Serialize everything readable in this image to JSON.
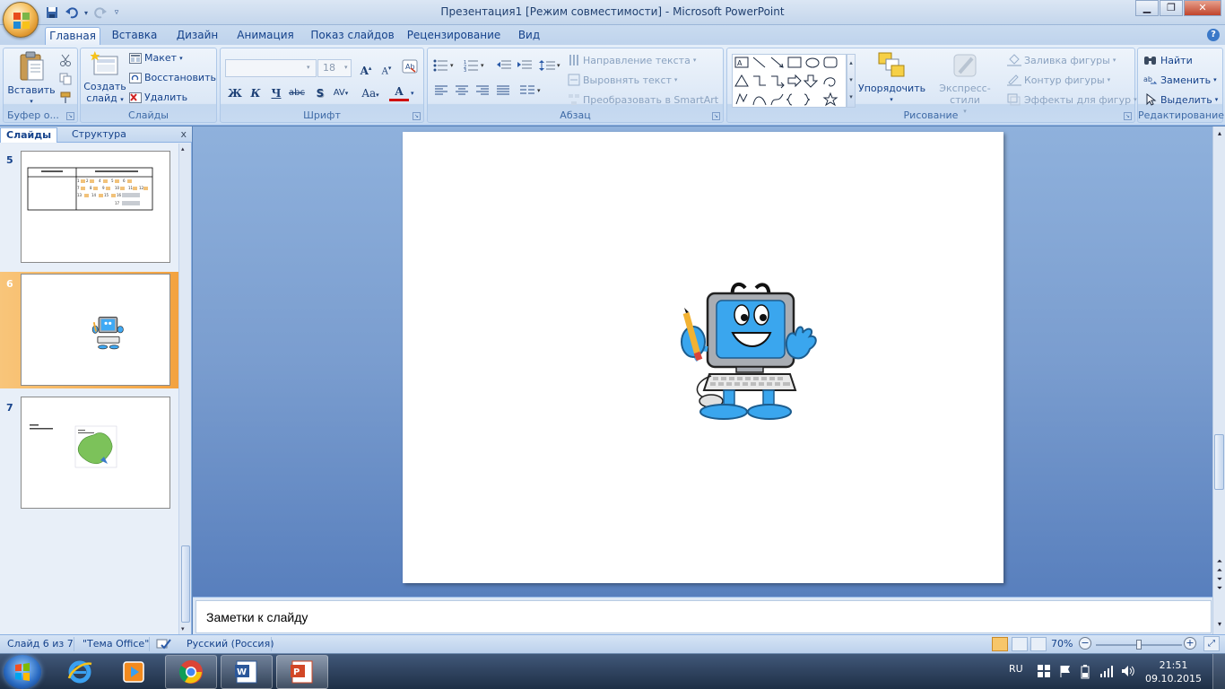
{
  "window": {
    "title": "Презентация1 [Режим совместимости] - Microsoft PowerPoint"
  },
  "tabs": [
    "Главная",
    "Вставка",
    "Дизайн",
    "Анимация",
    "Показ слайдов",
    "Рецензирование",
    "Вид"
  ],
  "active_tab": "Главная",
  "ribbon": {
    "clipboard": {
      "label": "Буфер о...",
      "paste": "Вставить"
    },
    "slides": {
      "label": "Слайды",
      "new_slide_line1": "Создать",
      "new_slide_line2": "слайд",
      "layout": "Макет",
      "reset": "Восстановить",
      "delete": "Удалить"
    },
    "font": {
      "label": "Шрифт",
      "font_name": "",
      "font_size": "18",
      "bold": "Ж",
      "italic": "К",
      "underline": "Ч",
      "strike": "abc",
      "shadow": "S",
      "spacing": "AV",
      "case": "Aa",
      "color": "A",
      "grow": "A",
      "shrink": "A"
    },
    "paragraph": {
      "label": "Абзац",
      "text_direction": "Направление текста",
      "align_text": "Выровнять текст",
      "smartart": "Преобразовать в SmartArt"
    },
    "drawing": {
      "label": "Рисование",
      "arrange": "Упорядочить",
      "quick_styles": "Экспресс-стили",
      "fill": "Заливка фигуры",
      "outline": "Контур фигуры",
      "effects": "Эффекты для фигур"
    },
    "editing": {
      "label": "Редактирование",
      "find": "Найти",
      "replace": "Заменить",
      "select": "Выделить"
    }
  },
  "left_panel": {
    "tab_slides": "Слайды",
    "tab_outline": "Структура",
    "close": "x",
    "thumbnails": [
      {
        "number": "5",
        "selected": false
      },
      {
        "number": "6",
        "selected": true
      },
      {
        "number": "7",
        "selected": false
      }
    ]
  },
  "notes": {
    "placeholder": "Заметки к слайду"
  },
  "status": {
    "slide_info": "Слайд 6 из 7",
    "theme": "\"Тема Office\"",
    "language": "Русский (Россия)",
    "zoom": "70%",
    "zoom_level_fraction": 0.5
  },
  "taskbar": {
    "language": "RU",
    "time": "21:51",
    "date": "09.10.2015",
    "apps": [
      "ie-icon",
      "media-icon",
      "chrome-icon",
      "word-icon",
      "powerpoint-icon"
    ]
  }
}
